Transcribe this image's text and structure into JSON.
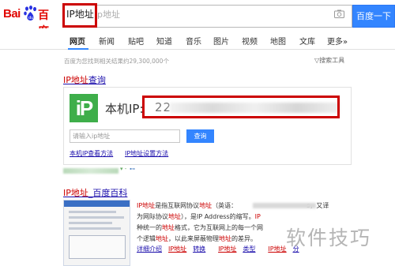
{
  "header": {
    "logo_bai": "Bai",
    "logo_du": "百度",
    "search_query": "IP地址",
    "search_ghost": "ip地址",
    "search_button": "百度一下"
  },
  "tabs": [
    {
      "label": "网页",
      "active": true
    },
    {
      "label": "新闻"
    },
    {
      "label": "贴吧"
    },
    {
      "label": "知道"
    },
    {
      "label": "音乐"
    },
    {
      "label": "图片"
    },
    {
      "label": "视频"
    },
    {
      "label": "地图"
    },
    {
      "label": "文库"
    },
    {
      "label": "更多»"
    }
  ],
  "results_meta": {
    "count_text": "百度为您找到相关结果约29,300,000个",
    "tools_text": "▽搜索工具"
  },
  "result1": {
    "title_hl": "IP地址",
    "title_rest": "查询",
    "logo_text": "iP",
    "ip_label": "本机IP:",
    "ip_value": "22",
    "input_placeholder": "请输入ip地址",
    "query_button": "查询",
    "link1": "本机IP查看方法",
    "link2": "IP地址设置方法",
    "url_arrow": "▾ -",
    "url_snapshot": "⊷"
  },
  "result2": {
    "title_hl": "IP地址",
    "title_rest": "_百度百科",
    "desc": [
      {
        "hl": "IP地址",
        "text": "是指互联网协议",
        "hl2": "地址",
        "text2": "（英语：",
        "tail": "s，又译"
      },
      {
        "text": "为网际协议",
        "hl": "地址",
        "text2": "），是IP Address的缩写。",
        "hl2": "IP"
      },
      {
        "text": "种统一的",
        "hl": "地址",
        "text2": "格式，它为互联网上的每一个网"
      },
      {
        "text": "个逻辑",
        "hl": "地址",
        "text2": "，以此来屏蔽物理",
        "hl2": "地址",
        "tail": "的差异。"
      }
    ],
    "links": [
      {
        "text": "详细介绍"
      },
      {
        "hl": "IP地址",
        "text": "转换"
      },
      {
        "hl": "IP地址",
        "text": "类型"
      },
      {
        "hl": "IP地址",
        "text": "分"
      }
    ]
  },
  "watermark": "软件技巧",
  "colors": {
    "brand_red": "#e10602",
    "link_blue": "#1a0dab",
    "accent_blue": "#3385ff",
    "highlight_red": "#cc0000",
    "ip_green": "#3eae4a"
  }
}
